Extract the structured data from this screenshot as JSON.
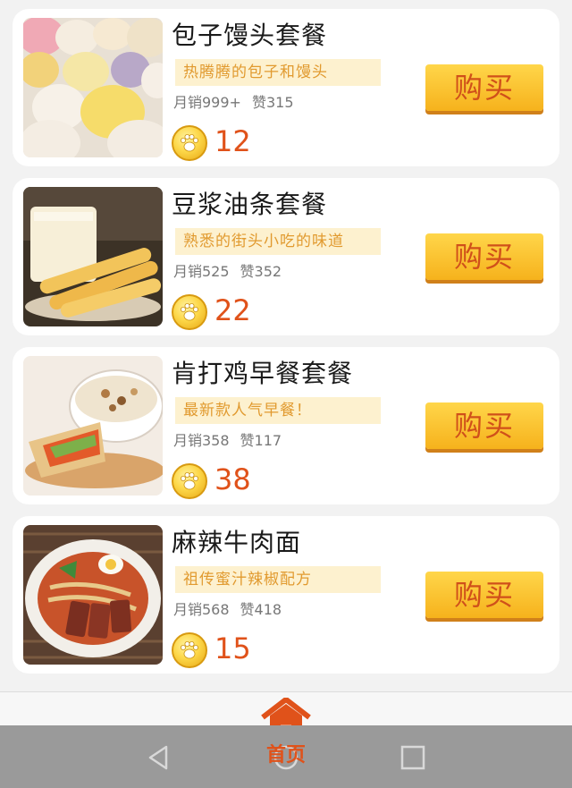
{
  "items": [
    {
      "title": "包子馒头套餐",
      "tag": "热腾腾的包子和馒头",
      "sales": "月销999+",
      "likes": "赞315",
      "price": "12",
      "image": "steamed-buns-photo"
    },
    {
      "title": "豆浆油条套餐",
      "tag": "熟悉的街头小吃的味道",
      "sales": "月销525",
      "likes": "赞352",
      "price": "22",
      "image": "soy-milk-fried-dough-photo"
    },
    {
      "title": "肯打鸡早餐套餐",
      "tag": "最新款人气早餐！",
      "sales": "月销358",
      "likes": "赞117",
      "price": "38",
      "image": "wrap-and-porridge-photo"
    },
    {
      "title": "麻辣牛肉面",
      "tag": "祖传蜜汁辣椒配方",
      "sales": "月销568",
      "likes": "赞418",
      "price": "15",
      "image": "spicy-beef-noodle-photo"
    }
  ],
  "buy_label": "购买",
  "tabbar": {
    "home_label": "首页"
  },
  "icons": {
    "coin": "paw-coin-icon",
    "home": "house-icon",
    "back": "triangle-back-icon",
    "home_nav": "circle-home-icon",
    "recent": "square-recents-icon"
  },
  "colors": {
    "price": "#e0521a",
    "tag_bg": "#fdf1cf",
    "tag_text": "#e19a2f",
    "button": "#f6b21c",
    "home_active": "#e0521a"
  }
}
